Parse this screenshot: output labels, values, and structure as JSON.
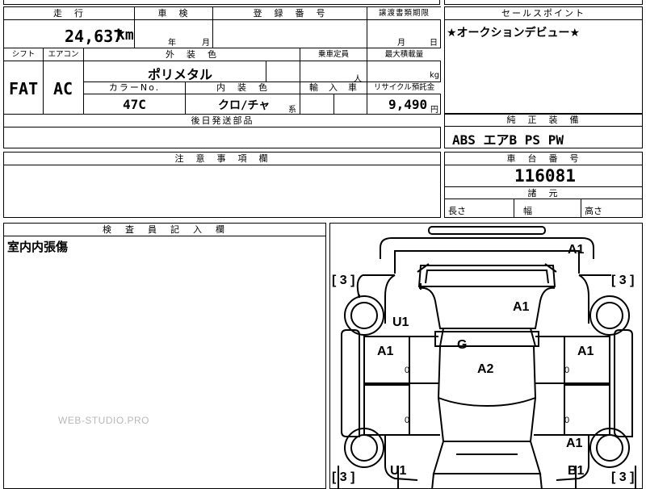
{
  "mileage": {
    "header": "走　行",
    "value": "24,637",
    "unit": "km"
  },
  "inspection": {
    "header": "車　検",
    "year_label": "年",
    "month_label": "月"
  },
  "registration": {
    "header": "登　録　番　号"
  },
  "transfer_deadline": {
    "header": "譲渡書類期限",
    "month_label": "月",
    "day_label": "日"
  },
  "shift": {
    "header": "シフト",
    "value": "FAT"
  },
  "aircon": {
    "header": "エアコン",
    "value": "AC"
  },
  "exterior_color": {
    "header": "外　装　色",
    "value": "ポリメタル"
  },
  "capacity": {
    "header": "乗車定員",
    "unit": "人"
  },
  "max_load": {
    "header": "最大積載量",
    "unit": "kg"
  },
  "color_no": {
    "header": "カラーNo.",
    "value": "47C"
  },
  "interior_color": {
    "header": "内　装　色",
    "value": "クロ/チャ",
    "suffix": "系"
  },
  "import_car": {
    "header": "輸　入　車"
  },
  "recycle_fee": {
    "header": "リサイクル預託金",
    "value": "9,490",
    "unit": "円"
  },
  "later_parts": {
    "header": "後日発送部品"
  },
  "notes": {
    "header": "注　意　事　項　欄"
  },
  "inspector_notes": {
    "header": "検　査　員　記　入　欄",
    "text": "室内内張傷"
  },
  "sales_point": {
    "header": "セールスポイント",
    "text": "★オークションデビュー★"
  },
  "equipment": {
    "header": "純　正　装　備",
    "value": "ABS エアB PS PW"
  },
  "chassis_number": {
    "header": "車　台　番　号",
    "value": "116081"
  },
  "specs": {
    "header": "諸　元",
    "length_label": "長さ",
    "width_label": "幅",
    "height_label": "高さ"
  },
  "diagram": {
    "marks": {
      "roof": "A1",
      "tl_bracket": "3",
      "tr_bracket": "3",
      "bl_bracket": "3",
      "br_bracket": "3",
      "hood": "A1",
      "front_left": "U1",
      "glass": "G",
      "left_front_door": "A1",
      "right_front_door": "A1",
      "center": "A2",
      "right_rear": "A1",
      "bottom_left": "U1",
      "bottom_right": "B1",
      "zero_lf": "0",
      "zero_rf": "0",
      "zero_lr": "0",
      "zero_rr": "0"
    }
  },
  "watermark": "WEB-STUDIO.PRO"
}
